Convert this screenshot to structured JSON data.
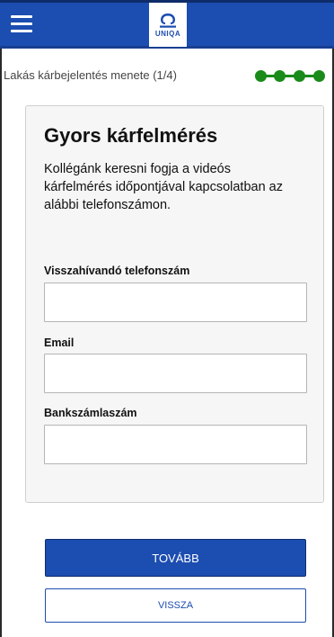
{
  "header": {
    "menu_icon": "hamburger-menu-icon",
    "logo_text": "UNIQA"
  },
  "progress": {
    "text": "Lakás kárbejelentés menete (1/4)",
    "steps_total": 4,
    "steps_completed": 4,
    "color": "#1a8a1a"
  },
  "card": {
    "title": "Gyors kárfelmérés",
    "description": "Kollégánk keresni fogja a videós kárfelmérés időpontjával kapcsolatban az alábbi telefonszámon.",
    "fields": [
      {
        "label": "Visszahívandó telefonszám",
        "value": "",
        "placeholder": ""
      },
      {
        "label": "Email",
        "value": "",
        "placeholder": ""
      },
      {
        "label": "Bankszámlaszám",
        "value": "",
        "placeholder": ""
      }
    ]
  },
  "actions": {
    "next_label": "TOVÁBB",
    "back_label": "VISSZA"
  },
  "colors": {
    "brand_blue": "#1c4db0",
    "progress_green": "#1a8a1a"
  }
}
